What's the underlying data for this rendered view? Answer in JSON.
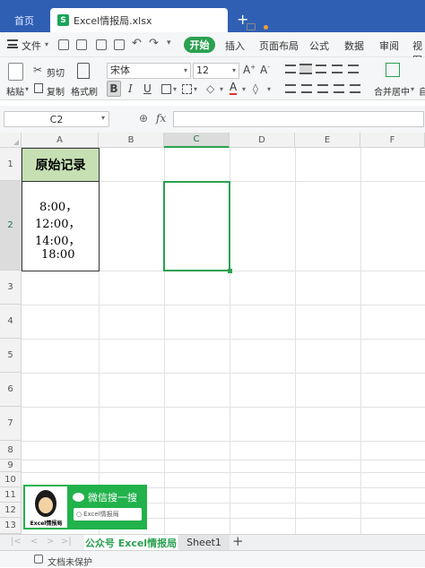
{
  "tabs": {
    "home": "首页",
    "document": "Excel情报局.xlsx",
    "new_tab": "+"
  },
  "menu": {
    "file": "文件",
    "start": "开始",
    "items": [
      "插入",
      "页面布局",
      "公式",
      "数据",
      "审阅",
      "视图"
    ]
  },
  "ribbon": {
    "paste": "粘贴",
    "cut": "剪切",
    "copy": "复制",
    "format_painter": "格式刷",
    "font_name": "宋体",
    "font_size": "12",
    "bold": "B",
    "italic": "I",
    "underline": "U",
    "merge_center": "合并居中",
    "auto": "自"
  },
  "formula_bar": {
    "name_box": "C2",
    "fx": "fx",
    "formula": ""
  },
  "columns": [
    "A",
    "B",
    "C",
    "D",
    "E",
    "F"
  ],
  "rows": [
    "1",
    "2",
    "3",
    "4",
    "5",
    "6",
    "7",
    "8",
    "9",
    "10",
    "11",
    "12",
    "13"
  ],
  "cells": {
    "A1": "原始记录",
    "A2": [
      "8:00，",
      "12:00，",
      "14:00，",
      "18:00"
    ]
  },
  "watermark": {
    "logo_text": "Excel情报局",
    "title": "微信搜一搜",
    "search_text": "Excel情报局"
  },
  "sheets": {
    "active": "公众号 Excel情报局",
    "other": "Sheet1",
    "add": "+"
  },
  "status": {
    "protect": "文档未保护"
  },
  "colors": {
    "accent": "#2aa150",
    "header_fill": "#c6e0b4",
    "title_bar": "#2f5fb3"
  }
}
